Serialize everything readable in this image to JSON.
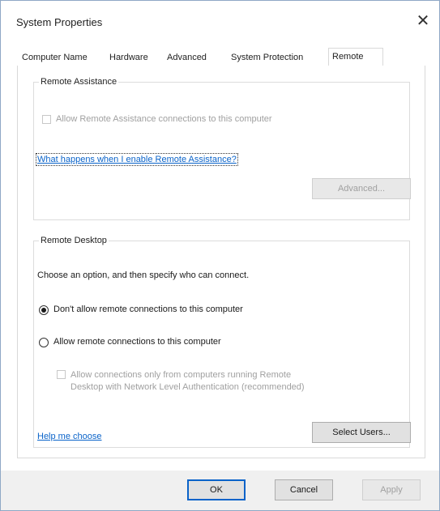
{
  "window": {
    "title": "System Properties",
    "close_glyph": "✕"
  },
  "tabs": [
    {
      "label": "Computer Name",
      "active": false
    },
    {
      "label": "Hardware",
      "active": false
    },
    {
      "label": "Advanced",
      "active": false
    },
    {
      "label": "System Protection",
      "active": false
    },
    {
      "label": "Remote",
      "active": true
    }
  ],
  "remote_assistance": {
    "legend": "Remote Assistance",
    "allow_label": "Allow Remote Assistance connections to this computer",
    "allow_checked": false,
    "help_link": "What happens when I enable Remote Assistance?",
    "advanced_button": "Advanced..."
  },
  "remote_desktop": {
    "legend": "Remote Desktop",
    "intro": "Choose an option, and then specify who can connect.",
    "option_dont_allow": "Don't allow remote connections to this computer",
    "option_allow": "Allow remote connections to this computer",
    "selected_option": "dont_allow",
    "nla_line1": "Allow connections only from computers running Remote",
    "nla_line2": "Desktop with Network Level Authentication (recommended)",
    "help_link": "Help me choose",
    "select_users_button": "Select Users..."
  },
  "footer": {
    "ok": "OK",
    "cancel": "Cancel",
    "apply": "Apply"
  },
  "colors": {
    "link": "#0a63c9",
    "default_button_border": "#0a63c9",
    "disabled_text": "#a0a0a0"
  }
}
